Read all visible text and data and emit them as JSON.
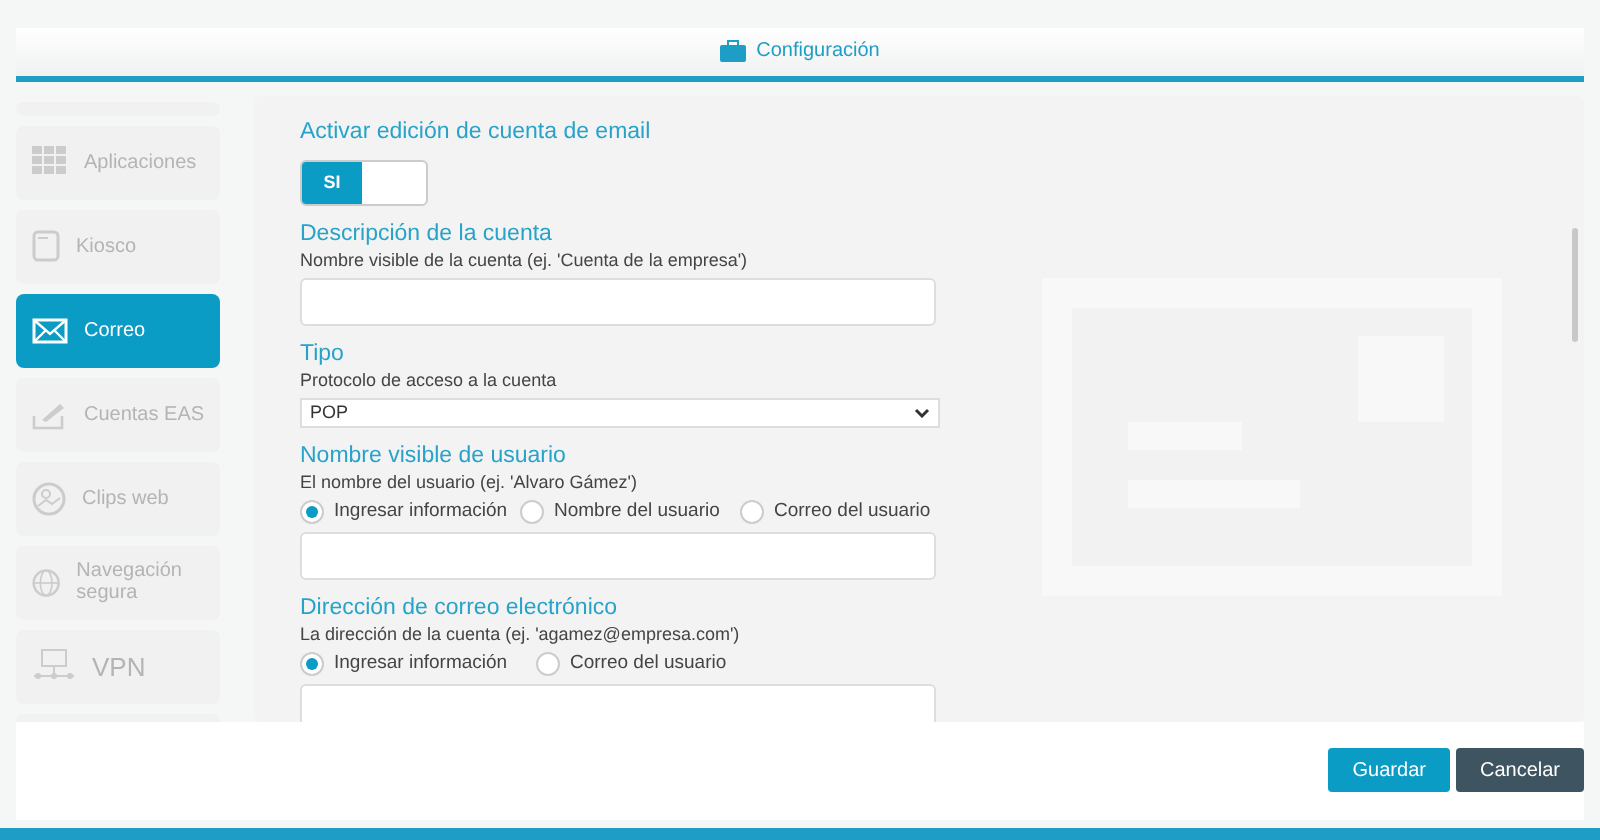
{
  "header": {
    "title": "Configuración"
  },
  "sidebar": {
    "items": [
      {
        "kind": "stub",
        "selected": false
      },
      {
        "label": "Aplicaciones",
        "kind": "grid",
        "selected": false
      },
      {
        "label": "Kiosco",
        "kind": "kiosk",
        "selected": false
      },
      {
        "label": "Correo",
        "kind": "mail",
        "selected": true
      },
      {
        "label": "Cuentas EAS",
        "kind": "sign",
        "selected": false
      },
      {
        "label": "Clips web",
        "kind": "image",
        "selected": false
      },
      {
        "label": "Navegación segura",
        "kind": "globe",
        "selected": false
      },
      {
        "label": "VPN",
        "kind": "vpn",
        "selected": false
      },
      {
        "kind": "stub",
        "selected": false
      }
    ]
  },
  "form": {
    "sections": [
      {
        "kind": "toggle",
        "title": "Activar edición de cuenta de email",
        "toggle": {
          "label": "SI",
          "on": true
        }
      },
      {
        "kind": "text",
        "title": "Descripción de la cuenta",
        "hint": "Nombre visible de la cuenta (ej. 'Cuenta de la empresa')"
      },
      {
        "kind": "select",
        "title": "Tipo",
        "hint": "Protocolo de acceso a la cuenta",
        "value": "POP"
      },
      {
        "kind": "radio_text",
        "title": "Nombre visible de usuario",
        "hint": "El nombre del usuario (ej. 'Alvaro Gámez')",
        "options": [
          {
            "label": "Ingresar información",
            "selected": true
          },
          {
            "label": "Nombre del usuario",
            "selected": false
          },
          {
            "label": "Correo del usuario",
            "selected": false
          }
        ]
      },
      {
        "kind": "radio_text",
        "title": "Dirección de correo electrónico",
        "hint": "La dirección de la cuenta (ej. 'agamez@empresa.com')",
        "options": [
          {
            "label": "Ingresar información",
            "selected": true
          },
          {
            "label": "Correo del usuario",
            "selected": false
          }
        ]
      }
    ]
  },
  "buttons": [
    {
      "label": "Guardar",
      "kind": "primary"
    },
    {
      "label": "Cancelar",
      "kind": "secondary"
    }
  ]
}
